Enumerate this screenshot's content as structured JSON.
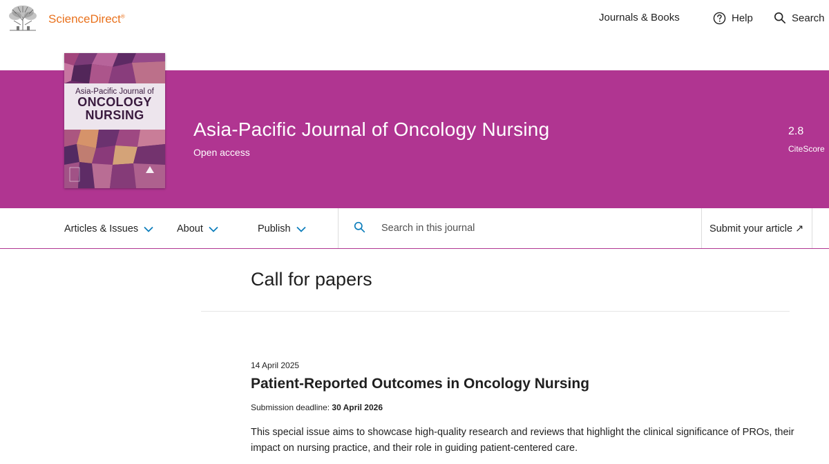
{
  "header": {
    "brand": "ScienceDirect",
    "brand_mark": "®",
    "nav": [
      {
        "label": "Journals & Books",
        "icon": ""
      },
      {
        "label": "Help",
        "icon": "help-circle-icon"
      },
      {
        "label": "Search",
        "icon": "search-icon"
      }
    ]
  },
  "journal": {
    "title": "Asia-Pacific Journal of Oncology Nursing",
    "access": "Open access",
    "citescore_value": "2.8",
    "citescore_label": "CiteScore",
    "cover": {
      "line1": "Asia-Pacific Journal of",
      "line2": "ONCOLOGY",
      "line3": "NURSING"
    }
  },
  "journal_nav": {
    "items": [
      {
        "label": "Articles & Issues"
      },
      {
        "label": "About"
      },
      {
        "label": "Publish"
      }
    ],
    "search_placeholder": "Search in this journal",
    "submit_label": "Submit your article ↗"
  },
  "content": {
    "page_title": "Call for papers",
    "calls": [
      {
        "date": "14 April 2025",
        "title": "Patient-Reported Outcomes in Oncology Nursing",
        "deadline_label": "Submission deadline: ",
        "deadline_value": "30 April 2026",
        "description": "This special issue aims to showcase high-quality research and reviews that highlight the clinical significance of PROs, their impact on nursing practice, and their role in guiding patient-centered care."
      }
    ]
  },
  "colors": {
    "banner": "#b03591",
    "brand": "#e9711c",
    "accent_icon": "#0c7dbb"
  }
}
